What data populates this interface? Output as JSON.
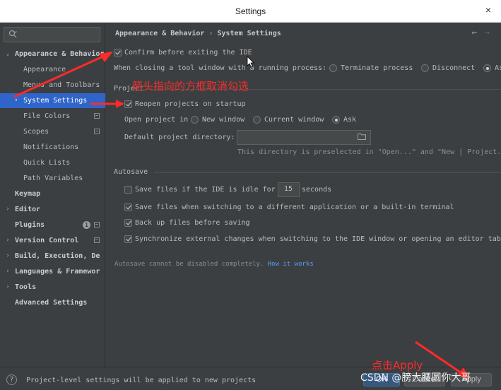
{
  "window": {
    "title": "Settings",
    "close_glyph": "×"
  },
  "search": {
    "placeholder": "",
    "icon": "search-icon"
  },
  "sidebar": {
    "items": [
      {
        "label": "Appearance & Behavior",
        "level": 0,
        "expanded": true,
        "bold": true
      },
      {
        "label": "Appearance",
        "level": 1
      },
      {
        "label": "Menus and Toolbars",
        "level": 1
      },
      {
        "label": "System Settings",
        "level": 1,
        "selected": true,
        "collapsed": true
      },
      {
        "label": "File Colors",
        "level": 1,
        "square": true
      },
      {
        "label": "Scopes",
        "level": 1,
        "square": true
      },
      {
        "label": "Notifications",
        "level": 1
      },
      {
        "label": "Quick Lists",
        "level": 1
      },
      {
        "label": "Path Variables",
        "level": 1
      },
      {
        "label": "Keymap",
        "level": 0,
        "bold": true
      },
      {
        "label": "Editor",
        "level": 0,
        "bold": true,
        "collapsed": true
      },
      {
        "label": "Plugins",
        "level": 0,
        "bold": true,
        "badge": "1",
        "square": true
      },
      {
        "label": "Version Control",
        "level": 0,
        "bold": true,
        "collapsed": true,
        "square": true
      },
      {
        "label": "Build, Execution, De",
        "level": 0,
        "bold": true,
        "collapsed": true
      },
      {
        "label": "Languages & Framewor",
        "level": 0,
        "bold": true,
        "collapsed": true
      },
      {
        "label": "Tools",
        "level": 0,
        "bold": true,
        "collapsed": true
      },
      {
        "label": "Advanced Settings",
        "level": 0,
        "bold": true
      }
    ]
  },
  "breadcrumb": {
    "parent": "Appearance & Behavior",
    "separator": "›",
    "current": "System Settings"
  },
  "nav": {
    "back": "←",
    "forward": "→"
  },
  "general": {
    "confirm_exit": {
      "label": "Confirm before exiting the IDE",
      "checked": true
    },
    "closing_tool_window": {
      "label": "When closing a tool window with a running process:",
      "options": [
        "Terminate process",
        "Disconnect",
        "As"
      ],
      "selected": 2
    }
  },
  "project": {
    "section_title": "Project",
    "reopen": {
      "label": "Reopen projects on startup",
      "checked": true
    },
    "open_in": {
      "label": "Open project in",
      "options": [
        "New window",
        "Current window",
        "Ask"
      ],
      "selected": 2
    },
    "default_dir": {
      "label": "Default project directory:",
      "value": "",
      "hint": "This directory is preselected in \"Open...\" and \"New | Project."
    }
  },
  "autosave": {
    "section_title": "Autosave",
    "idle": {
      "label_before": "Save files if the IDE is idle for",
      "value": "15",
      "label_after": "seconds",
      "checked": false
    },
    "switching": {
      "label": "Save files when switching to a different application or a built-in terminal",
      "checked": true
    },
    "backup": {
      "label": "Back up files before saving",
      "checked": true
    },
    "sync": {
      "label": "Synchronize external changes when switching to the IDE window or opening an editor tab",
      "checked": true
    },
    "note": "Autosave cannot be disabled completely.",
    "note_link": "How it works"
  },
  "footer": {
    "help": "?",
    "message": "Project-level settings will be applied to new projects",
    "ok": "OK",
    "cancel": "Cancel",
    "apply": "Apply"
  },
  "annotations": {
    "arrow_note": "箭头指向的方框取消勾选",
    "apply_note": "点击Apply",
    "color": "#ff2a2a"
  },
  "watermark": "CSDN @膀大腰圆你大哥"
}
